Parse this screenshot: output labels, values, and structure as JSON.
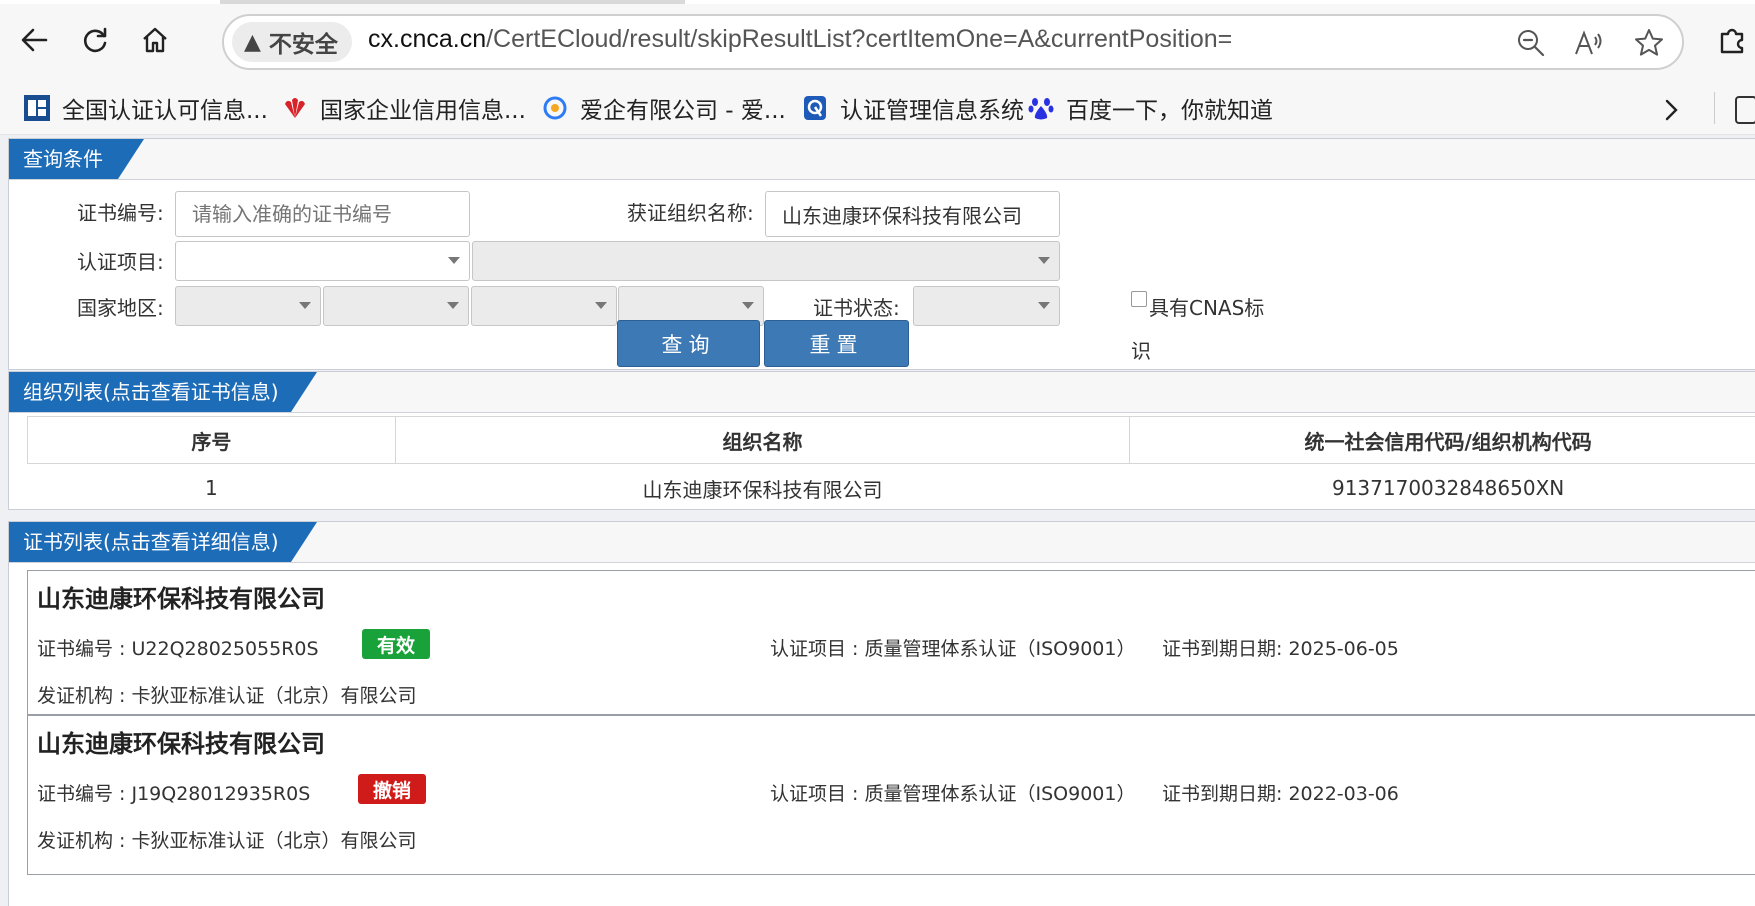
{
  "browser": {
    "security_label": "不安全",
    "url_host": "cx.cnca.cn",
    "url_path": "/CertECloud/result/skipResultList?certItemOne=A&currentPosition=",
    "bookmarks": [
      {
        "label": "全国认证认可信息..."
      },
      {
        "label": "国家企业信用信息..."
      },
      {
        "label": "爱企有限公司 - 爱..."
      },
      {
        "label": "认证管理信息系统"
      },
      {
        "label": "百度一下，你就知道"
      }
    ]
  },
  "query": {
    "section_title": "查询条件",
    "cert_no_label": "证书编号:",
    "cert_no_placeholder": "请输入准确的证书编号",
    "org_name_label": "获证组织名称:",
    "org_name_value": "山东迪康环保科技有限公司",
    "cert_item_label": "认证项目:",
    "region_label": "国家地区:",
    "status_label": "证书状态:",
    "cnas_label_line1": "具有CNAS标",
    "cnas_label_line2": "识",
    "search_button": "查询",
    "reset_button": "重置"
  },
  "org_list": {
    "section_title": "组织列表(点击查看证书信息)",
    "columns": [
      "序号",
      "组织名称",
      "统一社会信用代码/组织机构代码"
    ],
    "rows": [
      [
        "1",
        "山东迪康环保科技有限公司",
        "913717003284865 0XN"
      ]
    ]
  },
  "cert_list": {
    "section_title": "证书列表(点击查看详细信息)",
    "items": [
      {
        "org_name": "山东迪康环保科技有限公司",
        "cert_no": "证书编号 : U22Q28025055R0S",
        "status": "有效",
        "status_color": "#1aa23a",
        "item": "认证项目 : 质量管理体系认证（ISO9001）",
        "expiry": "证书到期日期: 2025-06-05",
        "issuer": "发证机构 : 卡狄亚标准认证（北京）有限公司"
      },
      {
        "org_name": "山东迪康环保科技有限公司",
        "cert_no": "证书编号 : J19Q28012935R0S",
        "status": "撤销",
        "status_color": "#d01b1b",
        "item": "认证项目 : 质量管理体系认证（ISO9001）",
        "expiry": "证书到期日期: 2022-03-06",
        "issuer": "发证机构 : 卡狄亚标准认证（北京）有限公司"
      }
    ]
  },
  "icons": [
    "back-arrow-icon",
    "refresh-icon",
    "home-icon",
    "warning-icon",
    "zoom-out-icon",
    "read-aloud-icon",
    "favorite-star-icon",
    "extensions-icon",
    "chevron-right-icon",
    "collections-icon"
  ]
}
